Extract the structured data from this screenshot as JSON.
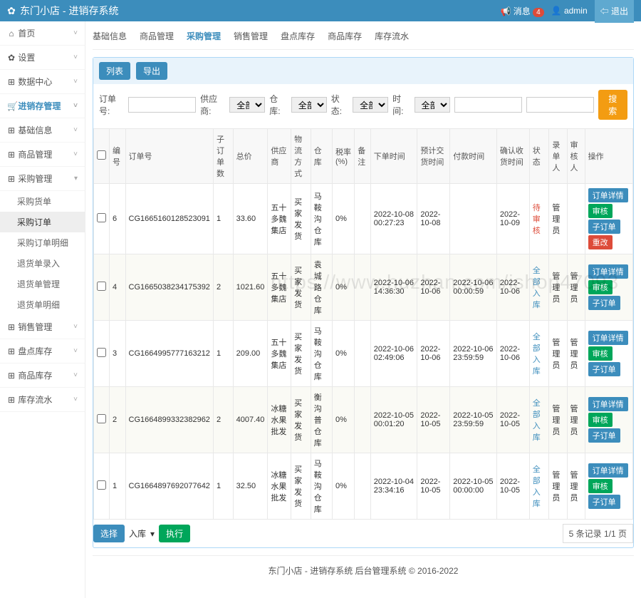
{
  "brand": "东门小店 - 进销存系统",
  "top": {
    "msg": "消息",
    "msg_count": "4",
    "user": "admin",
    "logout": "退出"
  },
  "sidebar": [
    {
      "label": "首页",
      "icon": "⌂"
    },
    {
      "label": "设置",
      "icon": "✿"
    },
    {
      "label": "数据中心",
      "icon": "⊞"
    },
    {
      "label": "进销存管理",
      "icon": "🛒",
      "active": true
    },
    {
      "label": "基础信息",
      "icon": "⊞"
    },
    {
      "label": "商品管理",
      "icon": "⊞"
    },
    {
      "label": "采购管理",
      "icon": "⊞",
      "expanded": true,
      "subs": [
        "采购货单",
        "采购订单",
        "采购订单明细",
        "退货单录入",
        "退货单管理",
        "退货单明细"
      ]
    },
    {
      "label": "销售管理",
      "icon": "⊞"
    },
    {
      "label": "盘点库存",
      "icon": "⊞"
    },
    {
      "label": "商品库存",
      "icon": "⊞"
    },
    {
      "label": "库存流水",
      "icon": "⊞"
    }
  ],
  "sub_active": "采购订单",
  "topnav": [
    "基础信息",
    "商品管理",
    "采购管理",
    "销售管理",
    "盘点库存",
    "商品库存",
    "库存流水"
  ],
  "topnav_active": "采购管理",
  "panel_btns": {
    "list": "列表",
    "export": "导出"
  },
  "filters": {
    "order_no": "订单号:",
    "supplier": "供应商:",
    "all": "全部",
    "warehouse": "仓库:",
    "status": "状态:",
    "time": "时间:",
    "search": "搜索"
  },
  "columns": [
    "",
    "编号",
    "订单号",
    "子订单数",
    "总价",
    "供应商",
    "物流方式",
    "仓库",
    "税率(%)",
    "备注",
    "下单时间",
    "预计交货时间",
    "付款时间",
    "确认收货时间",
    "状态",
    "录单人",
    "审核人",
    "操作"
  ],
  "rows": [
    {
      "no": "6",
      "order": "CG1665160128523091",
      "sub": "1",
      "price": "33.60",
      "sup": "五十多魏集店",
      "ship": "买家发货",
      "wh": "马鞍沟仓库",
      "tax": "0%",
      "remark": "",
      "t1": "2022-10-08 00:27:23",
      "t2": "2022-10-08",
      "t3": "",
      "t4": "2022-10-09",
      "status": "待审核",
      "status_cls": "status-red",
      "u1": "管理员",
      "u2": "",
      "ops": [
        "订单详情",
        "审核",
        "子订单",
        "重改"
      ]
    },
    {
      "no": "4",
      "order": "CG1665038234175392",
      "sub": "2",
      "price": "1021.60",
      "sup": "五十多魏集店",
      "ship": "买家发货",
      "wh": "袁城路仓库",
      "tax": "0%",
      "remark": "",
      "t1": "2022-10-06 14:36:30",
      "t2": "2022-10-06",
      "t3": "2022-10-06 00:00:59",
      "t4": "2022-10-06",
      "status": "全部入库",
      "status_cls": "status-blue",
      "u1": "管理员",
      "u2": "管理员",
      "ops": [
        "订单详情",
        "审核",
        "子订单"
      ]
    },
    {
      "no": "3",
      "order": "CG1664995777163212",
      "sub": "1",
      "price": "209.00",
      "sup": "五十多魏集店",
      "ship": "买家发货",
      "wh": "马鞍沟仓库",
      "tax": "0%",
      "remark": "",
      "t1": "2022-10-06 02:49:06",
      "t2": "2022-10-06",
      "t3": "2022-10-06 23:59:59",
      "t4": "2022-10-06",
      "status": "全部入库",
      "status_cls": "status-blue",
      "u1": "管理员",
      "u2": "管理员",
      "ops": [
        "订单详情",
        "审核",
        "子订单"
      ]
    },
    {
      "no": "2",
      "order": "CG1664899332382962",
      "sub": "2",
      "price": "4007.40",
      "sup": "冰糖水果批发",
      "ship": "买家发货",
      "wh": "衡沟普仓库",
      "tax": "0%",
      "remark": "",
      "t1": "2022-10-05 00:01:20",
      "t2": "2022-10-05",
      "t3": "2022-10-05 23:59:59",
      "t4": "2022-10-05",
      "status": "全部入库",
      "status_cls": "status-blue",
      "u1": "管理员",
      "u2": "管理员",
      "ops": [
        "订单详情",
        "审核",
        "子订单"
      ]
    },
    {
      "no": "1",
      "order": "CG1664897692077642",
      "sub": "1",
      "price": "32.50",
      "sup": "冰糖水果批发",
      "ship": "买家发货",
      "wh": "马鞍沟仓库",
      "tax": "0%",
      "remark": "",
      "t1": "2022-10-04 23:34:16",
      "t2": "2022-10-05",
      "t3": "2022-10-05 00:00:00",
      "t4": "2022-10-05",
      "status": "全部入库",
      "status_cls": "status-blue",
      "u1": "管理员",
      "u2": "管理员",
      "ops": [
        "订单详情",
        "审核",
        "子订单"
      ]
    }
  ],
  "foot": {
    "select": "选择",
    "inbound": "入库",
    "exec": "执行",
    "page": "5 条记录 1/1 页"
  },
  "footer": "东门小店 - 进销存系统 后台管理系统 © 2016-2022",
  "watermark": "https://www.huzhan.com/ishop47093"
}
